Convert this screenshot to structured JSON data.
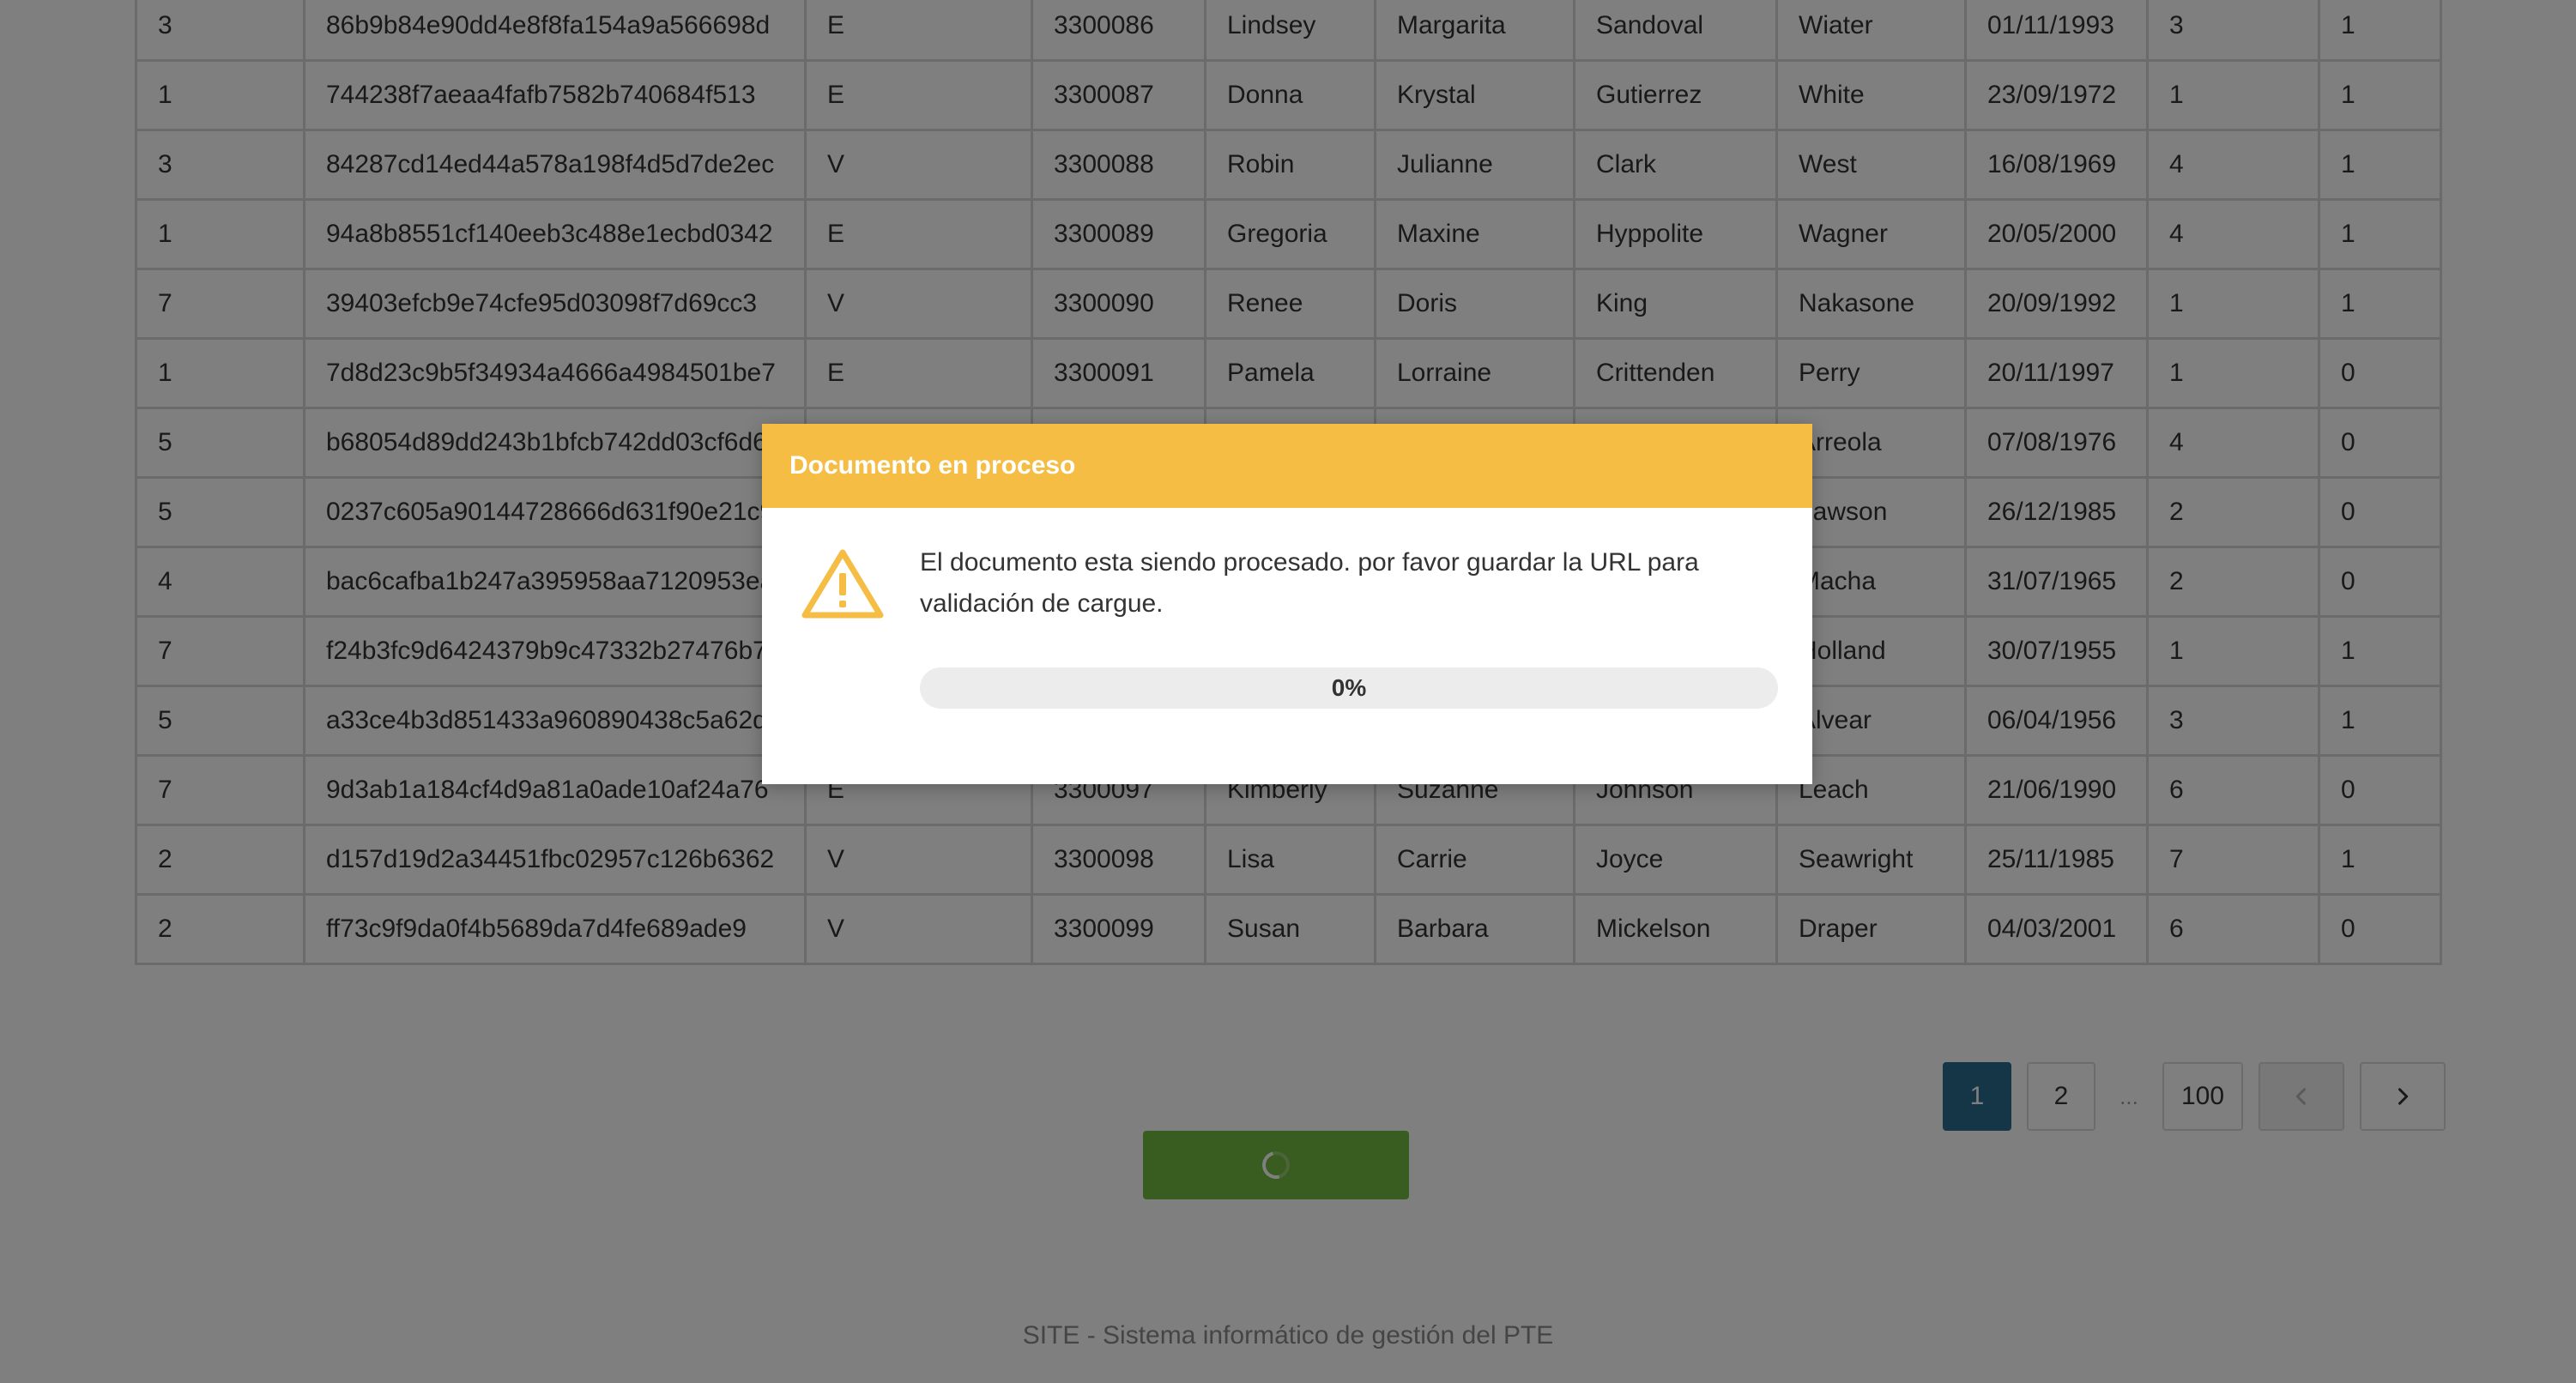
{
  "table": {
    "rows": [
      [
        "3",
        "86b9b84e90dd4e8f8fa154a9a566698d",
        "E",
        "3300086",
        "Lindsey",
        "Margarita",
        "Sandoval",
        "Wiater",
        "01/11/1993",
        "3",
        "1"
      ],
      [
        "1",
        "744238f7aeaa4fafb7582b740684f513",
        "E",
        "3300087",
        "Donna",
        "Krystal",
        "Gutierrez",
        "White",
        "23/09/1972",
        "1",
        "1"
      ],
      [
        "3",
        "84287cd14ed44a578a198f4d5d7de2ec",
        "V",
        "3300088",
        "Robin",
        "Julianne",
        "Clark",
        "West",
        "16/08/1969",
        "4",
        "1"
      ],
      [
        "1",
        "94a8b8551cf140eeb3c488e1ecbd0342",
        "E",
        "3300089",
        "Gregoria",
        "Maxine",
        "Hyppolite",
        "Wagner",
        "20/05/2000",
        "4",
        "1"
      ],
      [
        "7",
        "39403efcb9e74cfe95d03098f7d69cc3",
        "V",
        "3300090",
        "Renee",
        "Doris",
        "King",
        "Nakasone",
        "20/09/1992",
        "1",
        "1"
      ],
      [
        "1",
        "7d8d23c9b5f34934a4666a4984501be7",
        "E",
        "3300091",
        "Pamela",
        "Lorraine",
        "Crittenden",
        "Perry",
        "20/11/1997",
        "1",
        "0"
      ],
      [
        "5",
        "b68054d89dd243b1bfcb742dd03cf6d6",
        "",
        "",
        "",
        "",
        "",
        "Arreola",
        "07/08/1976",
        "4",
        "0"
      ],
      [
        "5",
        "0237c605a90144728666d631f90e21c9",
        "",
        "",
        "",
        "",
        "",
        "Lawson",
        "26/12/1985",
        "2",
        "0"
      ],
      [
        "4",
        "bac6cafba1b247a395958aa7120953ea",
        "",
        "",
        "",
        "",
        "",
        "Macha",
        "31/07/1965",
        "2",
        "0"
      ],
      [
        "7",
        "f24b3fc9d6424379b9c47332b27476b7",
        "",
        "",
        "",
        "",
        "",
        "Holland",
        "30/07/1955",
        "1",
        "1"
      ],
      [
        "5",
        "a33ce4b3d851433a960890438c5a62d3",
        "",
        "",
        "",
        "",
        "",
        "Alvear",
        "06/04/1956",
        "3",
        "1"
      ],
      [
        "7",
        "9d3ab1a184cf4d9a81a0ade10af24a76",
        "E",
        "3300097",
        "Kimberly",
        "Suzanne",
        "Johnson",
        "Leach",
        "21/06/1990",
        "6",
        "0"
      ],
      [
        "2",
        "d157d19d2a34451fbc02957c126b6362",
        "V",
        "3300098",
        "Lisa",
        "Carrie",
        "Joyce",
        "Seawright",
        "25/11/1985",
        "7",
        "1"
      ],
      [
        "2",
        "ff73c9f9da0f4b5689da7d4fe689ade9",
        "V",
        "3300099",
        "Susan",
        "Barbara",
        "Mickelson",
        "Draper",
        "04/03/2001",
        "6",
        "0"
      ]
    ]
  },
  "pagination": {
    "pages": [
      "1",
      "2"
    ],
    "ellipsis": "...",
    "last_page": "100",
    "current_page": "1",
    "prev_icon": "chevron-left-icon",
    "next_icon": "chevron-right-icon"
  },
  "submit": {
    "state": "loading",
    "icon": "spinner-icon",
    "color": "#73b840"
  },
  "footer": {
    "text": "SITE - Sistema informático de gestión del PTE"
  },
  "modal": {
    "title": "Documento en proceso",
    "icon": "warning-icon",
    "message": "El documento esta siendo procesado. por favor guardar la URL para validación de cargue.",
    "progress_label": "0%",
    "progress_value": 0,
    "header_color": "#f5bd43"
  },
  "colors": {
    "accent_blue": "#2b6c8f",
    "warning_yellow": "#f5bd43",
    "success_green": "#73b840"
  }
}
